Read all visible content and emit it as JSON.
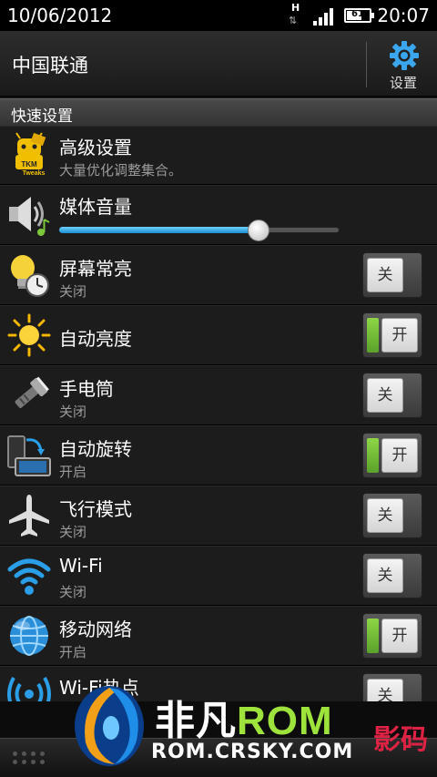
{
  "status_bar": {
    "date": "10/06/2012",
    "time": "20:07",
    "network_type": "H",
    "battery_level": "61",
    "signal_bars": 4
  },
  "header": {
    "carrier": "中国联通",
    "settings_label": "设置"
  },
  "section": {
    "title": "快速设置"
  },
  "items": [
    {
      "title": "高级设置",
      "subtitle": "大量优化调整集合。",
      "icon": "tweaks-icon"
    },
    {
      "title": "媒体音量",
      "icon": "volume-icon",
      "volume_fraction": 0.71
    },
    {
      "title": "屏幕常亮",
      "subtitle": "关闭",
      "icon": "bulb-clock-icon",
      "toggle": "关",
      "on": false
    },
    {
      "title": "自动亮度",
      "subtitle": "",
      "icon": "sun-icon",
      "toggle": "开",
      "on": true
    },
    {
      "title": "手电筒",
      "subtitle": "关闭",
      "icon": "flashlight-icon",
      "toggle": "关",
      "on": false
    },
    {
      "title": "自动旋转",
      "subtitle": "开启",
      "icon": "rotate-icon",
      "toggle": "开",
      "on": true
    },
    {
      "title": "飞行模式",
      "subtitle": "关闭",
      "icon": "airplane-icon",
      "toggle": "关",
      "on": false
    },
    {
      "title": "Wi-Fi",
      "subtitle": "关闭",
      "icon": "wifi-icon",
      "toggle": "关",
      "on": false
    },
    {
      "title": "移动网络",
      "subtitle": "开启",
      "icon": "globe-icon",
      "toggle": "开",
      "on": true
    },
    {
      "title": "Wi-Fi热点",
      "subtitle": "",
      "icon": "hotspot-icon",
      "toggle": "关",
      "on": false
    }
  ],
  "watermark": {
    "brand_prefix": "非凡",
    "brand_rom": "ROM",
    "url": "ROM.CRSKY.COM",
    "right_text": "影码"
  },
  "colors": {
    "accent_blue": "#2a9ee6",
    "toggle_on_green": "#7cc83a"
  }
}
